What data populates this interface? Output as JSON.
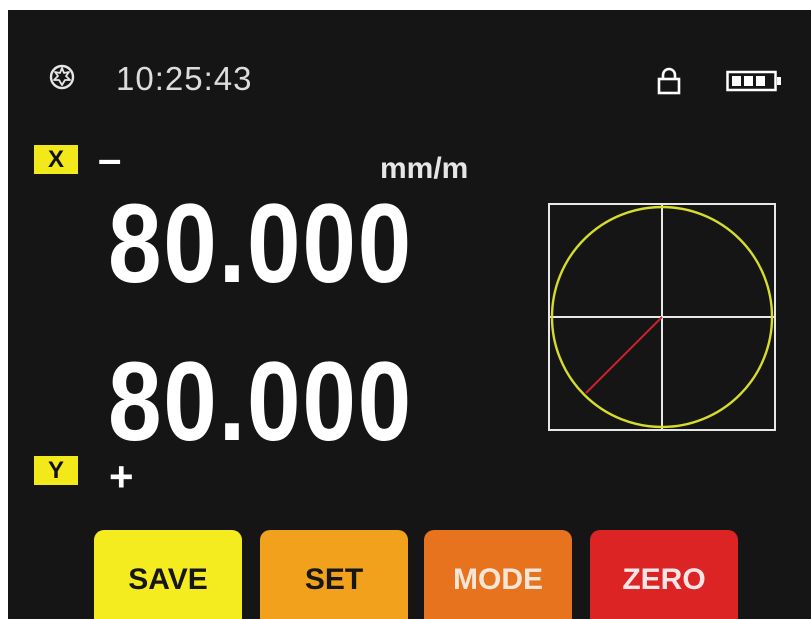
{
  "status": {
    "time": "10:25:43",
    "icons": [
      "gear-icon",
      "lock-icon",
      "battery-icon"
    ]
  },
  "x_axis": {
    "tag": "X",
    "sign": "–",
    "unit": "mm/m",
    "value": "80.000"
  },
  "y_axis": {
    "tag": "Y",
    "sign": "+",
    "value": "80.000"
  },
  "buttons": {
    "save": "SAVE",
    "set": "SET",
    "mode": "MODE",
    "zero": "ZERO"
  },
  "colors": {
    "background": "#151515",
    "tag_yellow": "#f2e91a",
    "save": "#f4ec1e",
    "set": "#f2a11c",
    "mode": "#e8731e",
    "zero": "#dd2424",
    "circle": "#d6dc2a",
    "vector": "#d0202a"
  },
  "bubble_plot": {
    "x_value": "-80.000",
    "y_value": "80.000"
  }
}
